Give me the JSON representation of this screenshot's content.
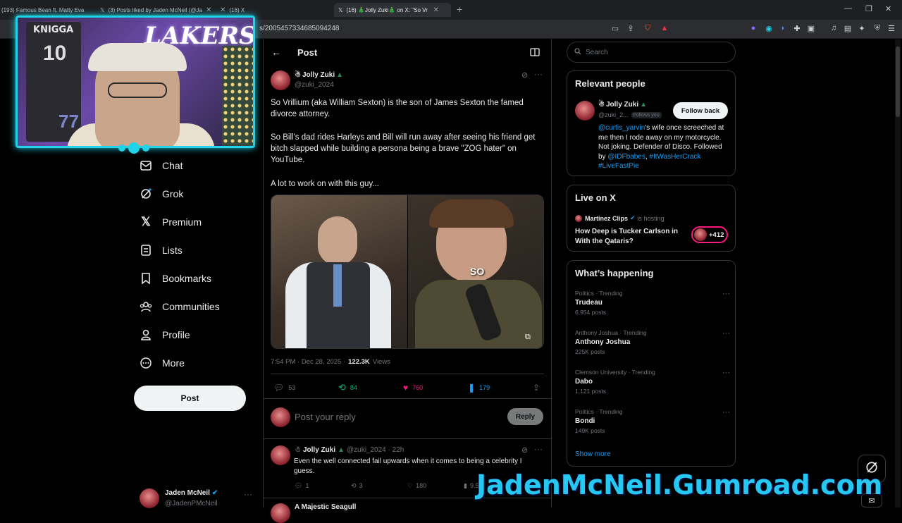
{
  "browser": {
    "tabs": [
      {
        "label": "(193) Famous Bean ft. Matty Eva"
      },
      {
        "label": "(3) Posts liked by Jaden McNeil (@Ja"
      },
      {
        "label": "(16) X"
      },
      {
        "label": "(16) 🎄Jolly Zuki🎄 on X: \"So Vr"
      }
    ],
    "url": "s/2005457334685094248"
  },
  "webcam": {
    "jersey_text": "KNIGGA",
    "jersey_number": "10",
    "jersey_number2": "77",
    "logo": "LAKERS"
  },
  "nav": {
    "items": [
      {
        "label": "Chat",
        "icon": "chat-icon"
      },
      {
        "label": "Grok",
        "icon": "grok-icon"
      },
      {
        "label": "Premium",
        "icon": "x-logo-icon"
      },
      {
        "label": "Lists",
        "icon": "lists-icon"
      },
      {
        "label": "Bookmarks",
        "icon": "bookmark-icon"
      },
      {
        "label": "Communities",
        "icon": "communities-icon"
      },
      {
        "label": "Profile",
        "icon": "profile-icon"
      },
      {
        "label": "More",
        "icon": "more-icon"
      }
    ],
    "post_button": "Post"
  },
  "account": {
    "name": "Jaden McNeil",
    "handle": "@JadenPMcNeil"
  },
  "post_header": {
    "title": "Post"
  },
  "tweet": {
    "author_name": "Jolly Zuki",
    "author_handle": "@zuki_2024",
    "paragraphs": [
      "So Vrillium (aka William Sexton) is the son of James Sexton the famed divorce attorney.",
      "So Bill's dad rides Harleys and Bill will run away after seeing his friend get bitch slapped while building a persona being a brave \"ZOG hater\" on YouTube.",
      "A lot to work on with this guy..."
    ],
    "image_caption": "SO",
    "time": "7:54 PM · Dec 28, 2025 ·",
    "views": "122.3K",
    "views_label": "Views",
    "replies": "53",
    "reposts": "84",
    "likes": "760",
    "bookmarks": "179"
  },
  "reply_box": {
    "placeholder": "Post your reply",
    "button": "Reply"
  },
  "reply_tweet": {
    "author_name": "Jolly Zuki",
    "meta": "@zuki_2024 · 22h",
    "text": "Even the well connected fail upwards when it comes to being a celebrity I guess.",
    "replies": "1",
    "reposts": "3",
    "likes": "180",
    "views": "9.5K"
  },
  "next_tweet": {
    "author_name": "A Majestic Seagull"
  },
  "search": {
    "placeholder": "Search"
  },
  "relevant": {
    "title": "Relevant people",
    "name": "Jolly Zuki",
    "handle": "@zuki_2...",
    "follows_you": "Follows you",
    "follow_button": "Follow back",
    "bio_1": "@curtis_yarvin",
    "bio_2": "'s wife once screeched at me then I rode away on my motorcycle. Not joking. Defender of Disco. Followed by ",
    "bio_3": "@IDFbabes",
    "bio_4": ", ",
    "bio_5": "#ItWasHerCrack",
    "bio_6": "#LiveFastPie"
  },
  "live": {
    "title": "Live on X",
    "host": "Martinez Clips",
    "hosting": "is hosting",
    "space_title": "How Deep is Tucker Carlson in With the Qataris?",
    "listeners": "+412"
  },
  "happening": {
    "title": "What’s happening",
    "trends": [
      {
        "context": "Politics · Trending",
        "name": "Trudeau",
        "posts": "6,954 posts"
      },
      {
        "context": "Anthony Joshua · Trending",
        "name": "Anthony Joshua",
        "posts": "225K posts"
      },
      {
        "context": "Clemson University · Trending",
        "name": "Dabo",
        "posts": "1,121 posts"
      },
      {
        "context": "Politics · Trending",
        "name": "Bondi",
        "posts": "149K posts"
      }
    ],
    "show_more": "Show more"
  },
  "watermark": "JadenMcNeil.Gumroad.com",
  "colors": {
    "accent": "#1d9bf0",
    "repost": "#00ba7c",
    "like": "#f91880",
    "bookmark": "#1d9bf0",
    "webcam_border": "#1fd3e8"
  }
}
